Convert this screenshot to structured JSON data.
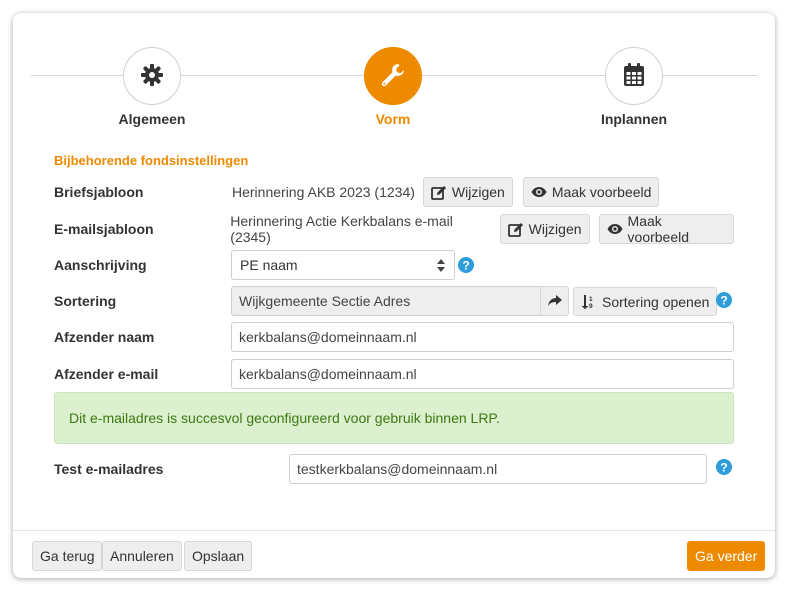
{
  "steps": [
    {
      "label": "Algemeen",
      "icon": "gear-icon",
      "active": false
    },
    {
      "label": "Vorm",
      "icon": "wrench-icon",
      "active": true
    },
    {
      "label": "Inplannen",
      "icon": "calendar-icon",
      "active": false
    }
  ],
  "colors": {
    "accent": "#ee8a00",
    "success_bg": "#dcefcf",
    "success_text": "#3c7a12"
  },
  "form": {
    "section_title": "Bijbehorende fondsinstellingen",
    "briefsjabloon": {
      "label": "Briefsjabloon",
      "value": "Herinnering AKB 2023 (1234)",
      "edit_label": "Wijzigen",
      "preview_label": "Maak voorbeeld"
    },
    "emailsjabloon": {
      "label": "E-mailsjabloon",
      "value": "Herinnering Actie Kerkbalans e-mail (2345)",
      "edit_label": "Wijzigen",
      "preview_label": "Maak voorbeeld"
    },
    "aanschrijving": {
      "label": "Aanschrijving",
      "selected": "PE naam"
    },
    "sortering": {
      "label": "Sortering",
      "value": "Wijkgemeente Sectie Adres",
      "open_label": "Sortering openen"
    },
    "afzender_naam": {
      "label": "Afzender naam",
      "value": "kerkbalans@domeinnaam.nl"
    },
    "afzender_email": {
      "label": "Afzender e-mail",
      "value": "kerkbalans@domeinnaam.nl"
    },
    "alert_text": "Dit e-mailadres is succesvol geconfigureerd voor gebruik binnen LRP.",
    "test_email": {
      "label": "Test e-mailadres",
      "value": "testkerkbalans@domeinnaam.nl"
    }
  },
  "footer": {
    "back_label": "Ga terug",
    "cancel_label": "Annuleren",
    "save_label": "Opslaan",
    "next_label": "Ga verder"
  }
}
